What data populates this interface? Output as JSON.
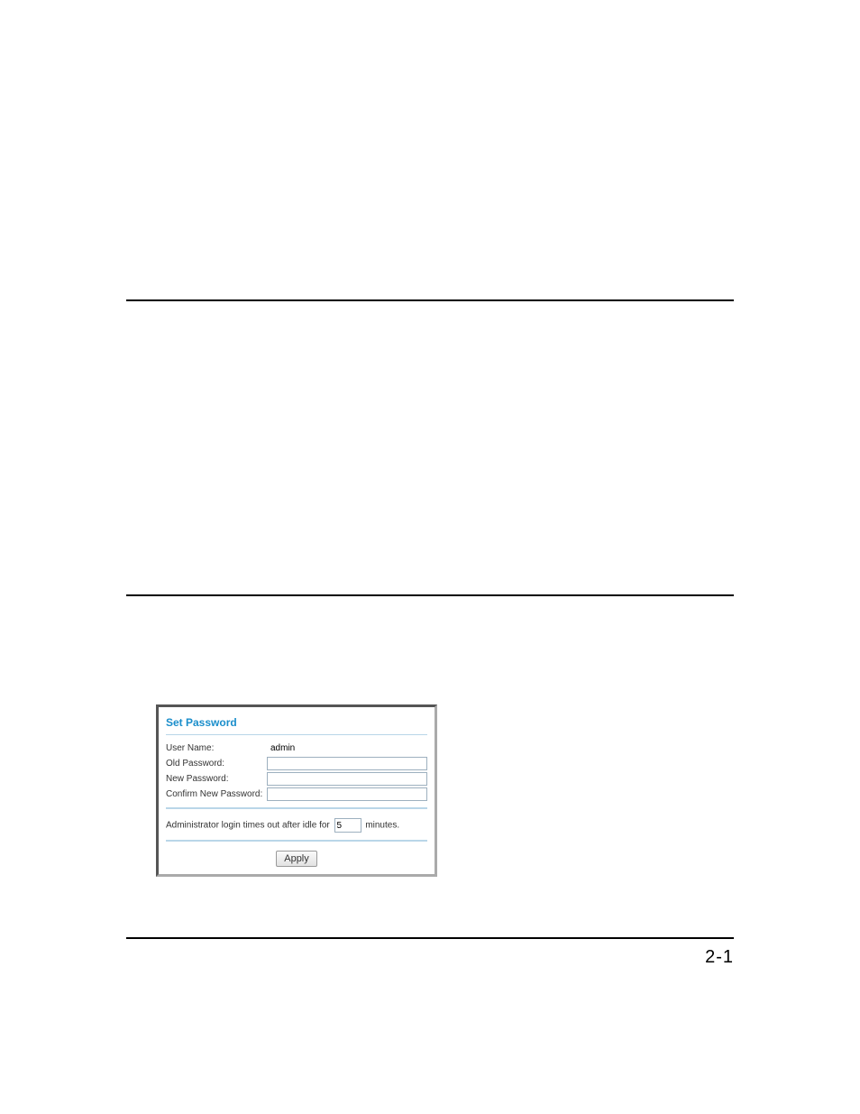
{
  "page_number": "2-1",
  "panel": {
    "title": "Set Password",
    "fields": {
      "user_name_label": "User Name:",
      "user_name_value": "admin",
      "old_password_label": "Old Password:",
      "old_password_value": "",
      "new_password_label": "New Password:",
      "new_password_value": "",
      "confirm_password_label": "Confirm New Password:",
      "confirm_password_value": ""
    },
    "timeout": {
      "prefix_text": "Administrator login times out after idle for",
      "value": "5",
      "suffix_text": "minutes."
    },
    "apply_label": "Apply"
  }
}
